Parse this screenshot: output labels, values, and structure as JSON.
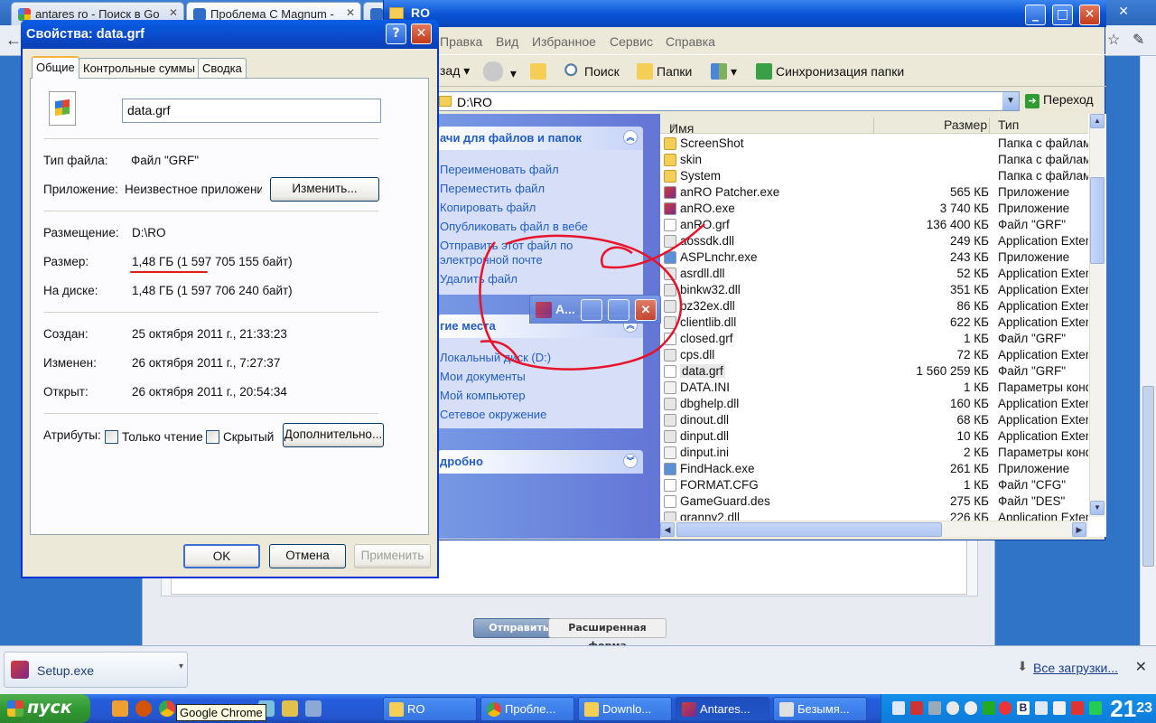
{
  "chrome": {
    "tabs": [
      {
        "label": "antares ro - Поиск в Go"
      },
      {
        "label": "Проблема С Magnum -"
      },
      {
        "label": "RO"
      }
    ],
    "buttons": {
      "send": "Отправить",
      "advanced": "Расширенная форма"
    },
    "downloads": {
      "item": "Setup.exe",
      "all": "Все загрузки..."
    }
  },
  "explorer": {
    "title": "RO",
    "menu": [
      "Правка",
      "Вид",
      "Избранное",
      "Сервис",
      "Справка"
    ],
    "toolbar": {
      "back_suffix": "зад",
      "search": "Поиск",
      "folders": "Папки",
      "sync": "Синхронизация папки"
    },
    "address": "D:\\RO",
    "go": "Переход",
    "tasks": {
      "header": "ачи для файлов и папок",
      "links": [
        "Переименовать файл",
        "Переместить файл",
        "Копировать файл",
        "Опубликовать файл в вебе",
        "Отправить этот файл по",
        "электронной почте",
        "Удалить файл"
      ]
    },
    "places": {
      "header": "гие места",
      "links": [
        "Локальный диск (D:)",
        "Мои документы",
        "Мой компьютер",
        "Сетевое окружение"
      ]
    },
    "details": {
      "header": "дробно"
    },
    "columns": {
      "name": "Имя",
      "size": "Размер",
      "type": "Тип"
    },
    "files": [
      {
        "name": "ScreenShot",
        "size": "",
        "type": "Папка с файлами",
        "icon": "folder"
      },
      {
        "name": "skin",
        "size": "",
        "type": "Папка с файлами",
        "icon": "folder"
      },
      {
        "name": "System",
        "size": "",
        "type": "Папка с файлами",
        "icon": "folder"
      },
      {
        "name": "anRO Patcher.exe",
        "size": "565 КБ",
        "type": "Приложение",
        "icon": "app"
      },
      {
        "name": "anRO.exe",
        "size": "3 740 КБ",
        "type": "Приложение",
        "icon": "app"
      },
      {
        "name": "anRO.grf",
        "size": "136 400 КБ",
        "type": "Файл \"GRF\"",
        "icon": "file"
      },
      {
        "name": "aossdk.dll",
        "size": "249 КБ",
        "type": "Application Extension",
        "icon": "dll"
      },
      {
        "name": "ASPLnchr.exe",
        "size": "243 КБ",
        "type": "Приложение",
        "icon": "exe"
      },
      {
        "name": "asrdll.dll",
        "size": "52 КБ",
        "type": "Application Extension",
        "icon": "dll"
      },
      {
        "name": "binkw32.dll",
        "size": "351 КБ",
        "type": "Application Extension",
        "icon": "dll"
      },
      {
        "name": "bz32ex.dll",
        "size": "86 КБ",
        "type": "Application Extension",
        "icon": "dll"
      },
      {
        "name": "clientlib.dll",
        "size": "622 КБ",
        "type": "Application Extension",
        "icon": "dll"
      },
      {
        "name": "closed.grf",
        "size": "1 КБ",
        "type": "Файл \"GRF\"",
        "icon": "file"
      },
      {
        "name": "cps.dll",
        "size": "72 КБ",
        "type": "Application Extension",
        "icon": "dll"
      },
      {
        "name": "data.grf",
        "size": "1 560 259 КБ",
        "type": "Файл \"GRF\"",
        "icon": "file",
        "selected": true
      },
      {
        "name": "DATA.INI",
        "size": "1 КБ",
        "type": "Параметры конфигурации",
        "icon": "ini"
      },
      {
        "name": "dbghelp.dll",
        "size": "160 КБ",
        "type": "Application Extension",
        "icon": "dll"
      },
      {
        "name": "dinout.dll",
        "size": "68 КБ",
        "type": "Application Extension",
        "icon": "dll"
      },
      {
        "name": "dinput.dll",
        "size": "10 КБ",
        "type": "Application Extension",
        "icon": "dll"
      },
      {
        "name": "dinput.ini",
        "size": "2 КБ",
        "type": "Параметры конфигурации",
        "icon": "ini"
      },
      {
        "name": "FindHack.exe",
        "size": "261 КБ",
        "type": "Приложение",
        "icon": "exe"
      },
      {
        "name": "FORMAT.CFG",
        "size": "1 КБ",
        "type": "Файл \"CFG\"",
        "icon": "file"
      },
      {
        "name": "GameGuard.des",
        "size": "275 КБ",
        "type": "Файл \"DES\"",
        "icon": "file"
      },
      {
        "name": "granny2.dll",
        "size": "226 КБ",
        "type": "Application Extension",
        "icon": "dll"
      }
    ]
  },
  "props": {
    "title": "Свойства: data.grf",
    "tabs": [
      "Общие",
      "Контрольные суммы",
      "Сводка"
    ],
    "filename": "data.grf",
    "rows": {
      "type_label": "Тип файла:",
      "type_value": "Файл \"GRF\"",
      "app_label": "Приложение:",
      "app_value": "Неизвестное приложение",
      "change_btn": "Изменить...",
      "loc_label": "Размещение:",
      "loc_value": "D:\\RO",
      "size_label": "Размер:",
      "size_value": "1,48 ГБ (1 597 705 155 байт)",
      "disk_label": "На диске:",
      "disk_value": "1,48 ГБ (1 597 706 240 байт)",
      "created_label": "Создан:",
      "created_value": "25 октября 2011 г., 21:33:23",
      "modified_label": "Изменен:",
      "modified_value": "26 октября 2011 г., 7:27:37",
      "opened_label": "Открыт:",
      "opened_value": "26 октября 2011 г., 20:54:34",
      "attr_label": "Атрибуты:",
      "readonly": "Только чтение",
      "hidden": "Скрытый",
      "advanced_btn": "Дополнительно..."
    },
    "buttons": {
      "ok": "OK",
      "cancel": "Отмена",
      "apply": "Применить"
    }
  },
  "mini_window": {
    "title": "A..."
  },
  "taskbar": {
    "start": "пуск",
    "tooltip": "Google Chrome",
    "items": [
      "RO",
      "Пробле...",
      "Downlo...",
      "Antares...",
      "Безымя..."
    ],
    "clock_hour": "21",
    "clock_min": "23"
  }
}
